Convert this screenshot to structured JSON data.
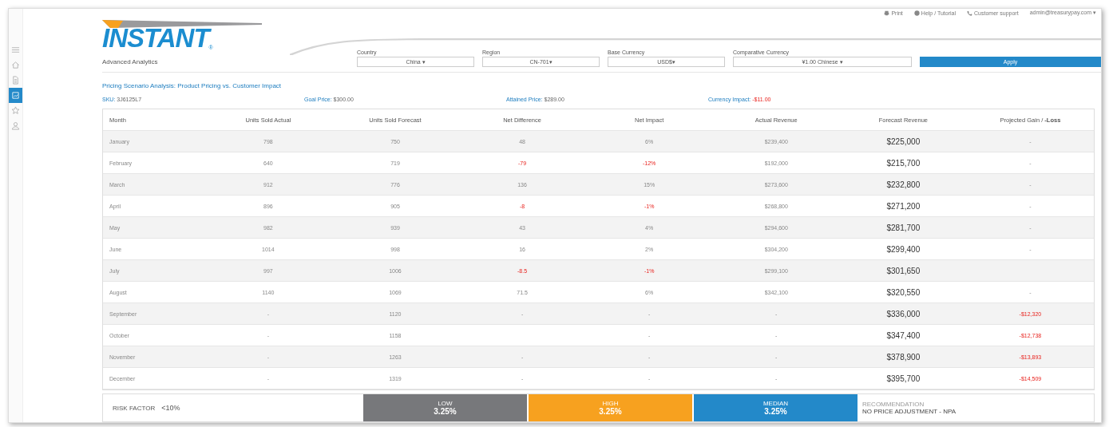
{
  "sidebar": {
    "items": [
      {
        "selected": false
      },
      {
        "selected": false
      },
      {
        "selected": false
      },
      {
        "selected": true
      },
      {
        "selected": false
      },
      {
        "selected": false
      }
    ]
  },
  "logo": {
    "text": "INSTANT",
    "mark": "®"
  },
  "top_links": [
    "Print",
    "Help / Tutorial",
    "Customer support",
    "admin@treasurypay.com ▾"
  ],
  "page_title": "Advanced Analytics",
  "filters": [
    {
      "label": "Country",
      "value": "China ▾"
    },
    {
      "label": "Region",
      "value": "CN-701▾"
    },
    {
      "label": "Base Currency",
      "value": "USD$▾"
    },
    {
      "label": "Comparative Currency",
      "value": "¥1.00 Chinese ▾"
    }
  ],
  "apply_button": "Apply",
  "analysis_title": "Pricing Scenario Analysis: Product Pricing vs. Customer Impact",
  "summary": [
    {
      "label": "SKU:",
      "value": "3J6125L7"
    },
    {
      "label": "Goal Price:",
      "value": "$300.00"
    },
    {
      "label": "Attained Price:",
      "value": "$289.00"
    },
    {
      "label": "Currency Impact:",
      "value": "-$11.00",
      "negative": true
    }
  ],
  "table": {
    "columns": [
      "Month",
      "Units Sold Actual",
      "Units Sold Forecast",
      "Net Difference",
      "Net Impact",
      "Actual Revenue",
      "Forecast Revenue",
      "Projected Gain / **-Loss**"
    ],
    "rows": [
      {
        "cells": [
          {
            "text": "January"
          },
          {
            "text": "798"
          },
          {
            "text": "750"
          },
          {
            "text": "48"
          },
          {
            "text": "6%"
          },
          {
            "text": "$239,400"
          },
          {
            "text": "$225,000"
          },
          {
            "text": "-"
          }
        ]
      },
      {
        "cells": [
          {
            "text": "February"
          },
          {
            "text": "640"
          },
          {
            "text": "719"
          },
          {
            "text": "-79",
            "negative": true
          },
          {
            "text": "-12%",
            "negative": true
          },
          {
            "text": "$192,000"
          },
          {
            "text": "$215,700"
          },
          {
            "text": "-"
          }
        ]
      },
      {
        "cells": [
          {
            "text": "March"
          },
          {
            "text": "912"
          },
          {
            "text": "776"
          },
          {
            "text": "136"
          },
          {
            "text": "15%"
          },
          {
            "text": "$273,600"
          },
          {
            "text": "$232,800"
          },
          {
            "text": "-"
          }
        ]
      },
      {
        "cells": [
          {
            "text": "April"
          },
          {
            "text": "896"
          },
          {
            "text": "905"
          },
          {
            "text": "-8",
            "negative": true
          },
          {
            "text": "-1%",
            "negative": true
          },
          {
            "text": "$268,800"
          },
          {
            "text": "$271,200"
          },
          {
            "text": "-"
          }
        ]
      },
      {
        "cells": [
          {
            "text": "May"
          },
          {
            "text": "982"
          },
          {
            "text": "939"
          },
          {
            "text": "43"
          },
          {
            "text": "4%"
          },
          {
            "text": "$294,600"
          },
          {
            "text": "$281,700"
          },
          {
            "text": "-"
          }
        ]
      },
      {
        "cells": [
          {
            "text": "June"
          },
          {
            "text": "1014"
          },
          {
            "text": "998"
          },
          {
            "text": "16"
          },
          {
            "text": "2%"
          },
          {
            "text": "$304,200"
          },
          {
            "text": "$299,400"
          },
          {
            "text": "-"
          }
        ]
      },
      {
        "cells": [
          {
            "text": "July"
          },
          {
            "text": "997"
          },
          {
            "text": "1006"
          },
          {
            "text": "-8.5",
            "negative": true
          },
          {
            "text": "-1%",
            "negative": true
          },
          {
            "text": "$299,100"
          },
          {
            "text": "$301,650"
          },
          null
        ]
      },
      {
        "cells": [
          {
            "text": "August"
          },
          {
            "text": "1140"
          },
          {
            "text": "1069"
          },
          {
            "text": "71.5"
          },
          {
            "text": "6%"
          },
          {
            "text": "$342,100"
          },
          {
            "text": "$320,550"
          },
          {
            "text": "-"
          }
        ]
      },
      {
        "cells": [
          {
            "text": "September"
          },
          {
            "text": "-"
          },
          {
            "text": "1120"
          },
          {
            "text": "-"
          },
          {
            "text": "-"
          },
          {
            "text": "-"
          },
          {
            "text": "$336,000"
          },
          {
            "text": "-$12,320",
            "negative": true
          }
        ]
      },
      {
        "cells": [
          {
            "text": "October"
          },
          {
            "text": "-"
          },
          {
            "text": "1158"
          },
          null,
          {
            "text": "-"
          },
          {
            "text": "-"
          },
          {
            "text": "$347,400"
          },
          {
            "text": "-$12,738",
            "negative": true
          }
        ]
      },
      {
        "cells": [
          {
            "text": "November"
          },
          {
            "text": "-"
          },
          {
            "text": "1263"
          },
          {
            "text": "-"
          },
          {
            "text": "-"
          },
          {
            "text": "-"
          },
          {
            "text": "$378,900"
          },
          {
            "text": "-$13,893",
            "negative": true
          }
        ]
      },
      {
        "cells": [
          {
            "text": "December"
          },
          {
            "text": "-"
          },
          {
            "text": "1319"
          },
          {
            "text": "-"
          },
          {
            "text": "-"
          },
          {
            "text": "-"
          },
          {
            "text": "$395,700"
          },
          {
            "text": "-$14,509",
            "negative": true
          }
        ]
      }
    ]
  },
  "risk": {
    "label": "RISK FACTOR",
    "value": "<10%",
    "levels": [
      {
        "name": "LOW",
        "value": "3.25%",
        "color": "#77787b"
      },
      {
        "name": "HIGH",
        "value": "3.25%",
        "color": "#f7a11f"
      },
      {
        "name": "MEDIAN",
        "value": "3.25%",
        "color": "#2389c9"
      }
    ],
    "recommendation_label": "RECOMMENDATION",
    "recommendation": "NO PRICE ADJUSTMENT - NPA"
  }
}
